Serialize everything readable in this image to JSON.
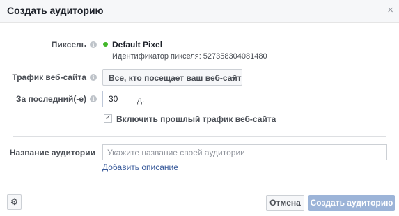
{
  "dialog": {
    "title": "Создать аудиторию",
    "close_glyph": "×"
  },
  "pixel": {
    "label": "Пиксель",
    "name": "Default Pixel",
    "id_text": "Идентификатор пикселя: 527358304081480",
    "status_color": "#42b72a"
  },
  "traffic": {
    "label": "Трафик веб-сайта",
    "selected": "Все, кто посещает ваш веб-сайт"
  },
  "period": {
    "label": "За последний(-е)",
    "value": "30",
    "unit": "д."
  },
  "include_past": {
    "checked": true,
    "label": "Включить прошлый трафик веб-сайта"
  },
  "audience_name": {
    "label": "Название аудитории",
    "placeholder": "Укажите название своей аудитории",
    "value": "",
    "add_description": "Добавить описание"
  },
  "footer": {
    "cancel_label": "Отмена",
    "create_label": "Создать аудиторию",
    "create_color": "#9cb4d8"
  },
  "icons": {
    "info": "i",
    "check": "✓",
    "gear": "⚙"
  }
}
